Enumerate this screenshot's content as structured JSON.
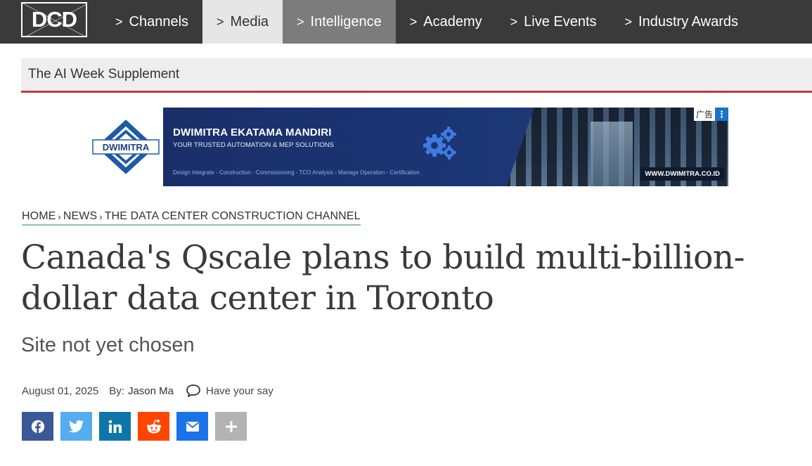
{
  "nav": {
    "logo_text": "DCD",
    "items": [
      {
        "label": "Channels",
        "chevron": ">"
      },
      {
        "label": "Media",
        "chevron": ">"
      },
      {
        "label": "Intelligence",
        "chevron": ">"
      },
      {
        "label": "Academy",
        "chevron": ">"
      },
      {
        "label": "Live Events",
        "chevron": ">"
      },
      {
        "label": "Industry Awards",
        "chevron": ">"
      }
    ]
  },
  "supplement": {
    "label": "The AI Week Supplement"
  },
  "ad": {
    "brand_logo_text": "DWIMITRA",
    "title": "DWIMITRA EKATAMA MANDIRI",
    "subtitle": "YOUR TRUSTED AUTOMATION & MEP SOLUTIONS",
    "services": "Design Integrate  -  Construction  -  Commissioning  -  TCO Analysis  -  Manage Operation  -  Certification",
    "url": "WWW.DWIMITRA.CO.ID",
    "ad_label": "广告",
    "menu_glyph": "⋮",
    "icon": "gears-icon"
  },
  "breadcrumb": {
    "items": [
      "HOME",
      "NEWS",
      "THE DATA CENTER CONSTRUCTION CHANNEL"
    ],
    "separator": "›"
  },
  "article": {
    "headline": "Canada's Qscale plans to build multi-billion-dollar data center in Toronto",
    "subheadline": "Site not yet chosen",
    "date": "August 01, 2025",
    "by_label": "By:",
    "author": "Jason Ma",
    "comment_label": "Have your say"
  },
  "share": {
    "buttons": [
      {
        "name": "facebook",
        "icon": "facebook-icon",
        "color": "#3b5998"
      },
      {
        "name": "twitter",
        "icon": "twitter-icon",
        "color": "#55acee"
      },
      {
        "name": "linkedin",
        "icon": "linkedin-icon",
        "color": "#0e76a8"
      },
      {
        "name": "reddit",
        "icon": "reddit-icon",
        "color": "#ff4500"
      },
      {
        "name": "email",
        "icon": "email-icon",
        "color": "#1a73e8"
      },
      {
        "name": "more",
        "icon": "plus-icon",
        "color": "#b3b3b3"
      }
    ]
  },
  "colors": {
    "nav_bg": "#3a3a3a",
    "accent_red": "#c0393b",
    "breadcrumb_underline": "#8fc2b8"
  }
}
